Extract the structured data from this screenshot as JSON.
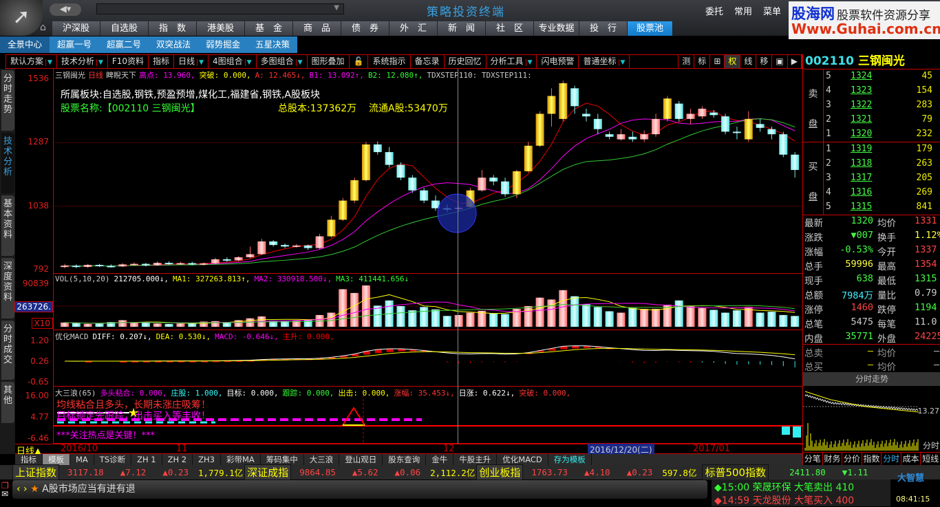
{
  "app": {
    "title": "策略投资终端",
    "top_links": [
      "委托",
      "常用",
      "菜单"
    ],
    "watermark": {
      "name": "股海网",
      "slogan": "股票软件资源分享",
      "url": "Www.Guhai.com.cn"
    }
  },
  "nav_tabs": [
    "沪深股",
    "自选股",
    "指　数",
    "港美股",
    "基　金",
    "商　品",
    "债　券",
    "外　汇",
    "新　闻",
    "社　区",
    "专业数据",
    "投　行",
    "股票池"
  ],
  "sub_tabs": [
    "全景中心",
    "超赢一号",
    "超赢二号",
    "双突战法",
    "弱势掘金",
    "五星决策"
  ],
  "toolbar": [
    {
      "label": "默认方案",
      "dd": true
    },
    {
      "label": "技术分析",
      "dd": true
    },
    {
      "label": "F10资料"
    },
    {
      "label": "指标"
    },
    {
      "label": "日线",
      "dd": true
    },
    {
      "label": "4图组合",
      "dd": true
    },
    {
      "label": "多图组合",
      "dd": true
    },
    {
      "label": "图形叠加"
    },
    {
      "label": "🔓"
    },
    {
      "label": "系统指示"
    },
    {
      "label": "备忘录"
    },
    {
      "label": "历史回忆"
    },
    {
      "label": "分析工具",
      "dd": true
    },
    {
      "label": "闪电预警"
    },
    {
      "label": "普通坐标",
      "dd": true
    }
  ],
  "toolbar_right": [
    "测",
    "标",
    "⊞",
    "权",
    "线",
    "移",
    "▣",
    "▶"
  ],
  "left_tabs": [
    "分时走势",
    "技术分析",
    "基本资料",
    "深度资料",
    "分时成交",
    "其他"
  ],
  "price_panel": {
    "name": "三钢闽光",
    "period": "日线",
    "indicator": "睥睨天下",
    "labels": [
      {
        "t": "高点: 13.960,",
        "c": "#f0f"
      },
      {
        "t": "突破: 0.000,",
        "c": "#ff0"
      },
      {
        "t": "A: 12.465↓,",
        "c": "#f33"
      },
      {
        "t": "B1: 13.092↑,",
        "c": "#f0f"
      },
      {
        "t": "B2: 12.080↑,",
        "c": "#3f3"
      },
      {
        "t": "TDXSTEP110: TDXSTEP111:",
        "c": "#ccc"
      }
    ],
    "sector": "所属板块:自选股,钢铁,预盈预增,煤化工,福建省,钢铁,A股板块",
    "stock_name": "股票名称:【002110 三钢闽光】",
    "total_shares": "总股本:137362万",
    "float_shares": "流通A股:53470万",
    "yaxis": [
      "1536",
      "1287",
      "1038",
      "792"
    ],
    "ylim": [
      792,
      1536
    ]
  },
  "candles": [
    [
      800,
      805,
      812,
      795
    ],
    [
      805,
      800,
      810,
      795
    ],
    [
      800,
      808,
      812,
      796
    ],
    [
      808,
      804,
      812,
      800
    ],
    [
      804,
      802,
      810,
      798
    ],
    [
      802,
      810,
      815,
      800
    ],
    [
      810,
      812,
      818,
      806
    ],
    [
      812,
      806,
      816,
      802
    ],
    [
      806,
      816,
      822,
      804
    ],
    [
      816,
      812,
      822,
      808
    ],
    [
      812,
      815,
      820,
      808
    ],
    [
      815,
      810,
      820,
      806
    ],
    [
      810,
      814,
      818,
      806
    ],
    [
      814,
      830,
      836,
      810
    ],
    [
      830,
      826,
      838,
      820
    ],
    [
      826,
      838,
      842,
      822
    ],
    [
      838,
      850,
      880,
      834
    ],
    [
      850,
      900,
      910,
      848
    ],
    [
      900,
      886,
      905,
      880
    ],
    [
      886,
      880,
      892,
      874
    ],
    [
      880,
      884,
      890,
      876
    ],
    [
      884,
      874,
      888,
      866
    ],
    [
      874,
      920,
      930,
      870
    ],
    [
      920,
      985,
      1000,
      915
    ],
    [
      985,
      1060,
      1070,
      980
    ],
    [
      1060,
      1140,
      1150,
      1050
    ],
    [
      1140,
      1280,
      1290,
      1135
    ],
    [
      1280,
      1250,
      1292,
      1240
    ],
    [
      1250,
      1200,
      1270,
      1190
    ],
    [
      1200,
      1150,
      1210,
      1140
    ],
    [
      1150,
      1100,
      1160,
      1090
    ],
    [
      1100,
      1060,
      1110,
      1050
    ],
    [
      1060,
      1030,
      1080,
      1020
    ],
    [
      1030,
      1028,
      1045,
      1015
    ],
    [
      1028,
      1032,
      1042,
      1018
    ],
    [
      1035,
      1100,
      1110,
      1030
    ],
    [
      1100,
      1150,
      1180,
      1095
    ],
    [
      1150,
      1135,
      1160,
      1120
    ],
    [
      1135,
      1085,
      1150,
      1075
    ],
    [
      1085,
      1175,
      1180,
      1070
    ],
    [
      1175,
      1275,
      1290,
      1170
    ],
    [
      1275,
      1400,
      1410,
      1270
    ],
    [
      1400,
      1470,
      1500,
      1350
    ],
    [
      1380,
      1520,
      1530,
      1370
    ],
    [
      1500,
      1430,
      1510,
      1400
    ],
    [
      1400,
      1390,
      1420,
      1370
    ],
    [
      1380,
      1340,
      1400,
      1320
    ],
    [
      1320,
      1310,
      1330,
      1300
    ],
    [
      1300,
      1320,
      1340,
      1295
    ],
    [
      1310,
      1300,
      1330,
      1290
    ],
    [
      1300,
      1320,
      1335,
      1290
    ],
    [
      1320,
      1380,
      1400,
      1310
    ],
    [
      1380,
      1460,
      1470,
      1370
    ],
    [
      1440,
      1380,
      1450,
      1370
    ],
    [
      1380,
      1400,
      1420,
      1360
    ],
    [
      1390,
      1420,
      1430,
      1380
    ],
    [
      1405,
      1395,
      1415,
      1385
    ],
    [
      1390,
      1330,
      1400,
      1320
    ],
    [
      1330,
      1325,
      1350,
      1300
    ],
    [
      1300,
      1380,
      1410,
      1290
    ],
    [
      1360,
      1345,
      1380,
      1330
    ],
    [
      1340,
      1320,
      1350,
      1300
    ],
    [
      1320,
      1240,
      1330,
      1230
    ],
    [
      1240,
      1180,
      1250,
      1150
    ]
  ],
  "volume_panel": {
    "header": [
      {
        "t": "VOL(5,10,20)",
        "c": "#ccc"
      },
      {
        "t": "212705.000↓,",
        "c": "#fff"
      },
      {
        "t": "MA1: 327263.813↑,",
        "c": "#ff0"
      },
      {
        "t": "MA2: 330918.500↓,",
        "c": "#f0f"
      },
      {
        "t": "MA3: 411441.656↓",
        "c": "#3f3"
      }
    ],
    "yaxis": [
      "90839",
      "263726.",
      "X10"
    ],
    "max": 908390,
    "values": [
      90000,
      80000,
      60000,
      70000,
      100000,
      140000,
      90000,
      100000,
      70000,
      60000,
      70000,
      70000,
      110000,
      120000,
      100000,
      140000,
      180000,
      220000,
      130000,
      120000,
      140000,
      150000,
      250000,
      300000,
      800000,
      720000,
      880000,
      450000,
      560000,
      440000,
      350000,
      420000,
      370000,
      230000,
      250000,
      300000,
      340000,
      290000,
      270000,
      380000,
      440000,
      620000,
      580000,
      780000,
      650000,
      480000,
      420000,
      330000,
      300000,
      400000,
      380000,
      380000,
      470000,
      560000,
      440000,
      400000,
      360000,
      300000,
      350000,
      420000,
      300000,
      320000,
      250000,
      230000
    ]
  },
  "macd_panel": {
    "header": [
      {
        "t": "优化MACD",
        "c": "#ccc"
      },
      {
        "t": "DIFF: 0.207↓,",
        "c": "#fff"
      },
      {
        "t": "DEA: 0.530↓,",
        "c": "#ff0"
      },
      {
        "t": "MACD: -0.646↓,",
        "c": "#f0f"
      },
      {
        "t": "主升: 0.000,",
        "c": "#f00"
      }
    ],
    "yaxis": [
      "1.20",
      "0.26",
      "-0.65"
    ]
  },
  "wave_panel": {
    "header": [
      {
        "t": "大三浪(65)",
        "c": "#ccc"
      },
      {
        "t": "多头粘合: 0.000,",
        "c": "#f0f"
      },
      {
        "t": "庄股: 1.000,",
        "c": "#3ff"
      },
      {
        "t": "目标: 0.000,",
        "c": "#fff"
      },
      {
        "t": "跟踪: 0.000,",
        "c": "#3f3"
      },
      {
        "t": "出击: 0.000,",
        "c": "#ff0"
      },
      {
        "t": "涨幅: 35.453↓,",
        "c": "#f33"
      },
      {
        "t": "日涨: 0.622↓,",
        "c": "#fff"
      },
      {
        "t": "突破: 0.000,",
        "c": "#f33"
      }
    ],
    "yaxis": [
      "16.00",
      "4.77",
      "-6.46"
    ],
    "msg1": "均线粘合且多头，长期未涨庄吸筹！",
    "msg2": "目标锁定先跟踪，出击买入等丰收！",
    "msg3": "***关注热点是关键！***"
  },
  "date_axis": {
    "period": "日线▲",
    "labels": [
      "2016/10",
      "11",
      "12",
      "2016/12/20(二)",
      "2017/01"
    ]
  },
  "bottom_tabs": [
    "指标",
    "模板",
    "MA",
    "TS诊断",
    "ZH 1",
    "ZH 2",
    "ZH3",
    "彩带MA",
    "筹码集中",
    "大三浪",
    "登山观日",
    "股东查询",
    "金牛",
    "牛股主升",
    "优化MACD",
    "存为模板"
  ],
  "quote": {
    "code": "002110",
    "name": "三钢闽光",
    "sell": [
      {
        "n": "5",
        "p": "1324",
        "v": "45"
      },
      {
        "n": "4",
        "p": "1323",
        "v": "154"
      },
      {
        "n": "3",
        "p": "1322",
        "v": "283"
      },
      {
        "n": "2",
        "p": "1321",
        "v": "79"
      },
      {
        "n": "1",
        "p": "1320",
        "v": "232"
      }
    ],
    "buy": [
      {
        "n": "1",
        "p": "1319",
        "v": "179"
      },
      {
        "n": "2",
        "p": "1318",
        "v": "263"
      },
      {
        "n": "3",
        "p": "1317",
        "v": "205"
      },
      {
        "n": "4",
        "p": "1316",
        "v": "269"
      },
      {
        "n": "5",
        "p": "1315",
        "v": "841"
      }
    ],
    "sell_label": [
      "卖",
      "盘"
    ],
    "buy_label": [
      "买",
      "盘"
    ],
    "stats": [
      [
        "最新",
        "1320",
        "#4f4",
        "均价",
        "1331",
        "#f44"
      ],
      [
        "涨跌",
        "▼007",
        "#4f4",
        "换手",
        "1.12%",
        "#ff4"
      ],
      [
        "涨幅",
        "-0.53%",
        "#4f4",
        "今开",
        "1337",
        "#f44"
      ],
      [
        "总手",
        "59996",
        "#ff4",
        "最高",
        "1354",
        "#f44"
      ],
      [
        "现手",
        "638",
        "#4f4",
        "最低",
        "1315",
        "#4f4"
      ],
      [
        "总额",
        "7984万",
        "#4ef",
        "量比",
        "0.79",
        "#ccc"
      ],
      [
        "涨停",
        "1460",
        "#f44",
        "跌停",
        "1194",
        "#4f4"
      ],
      [
        "总笔",
        "5475",
        "#ccc",
        "每笔",
        "11.0",
        "#ccc"
      ],
      [
        "内盘",
        "35771",
        "#4f4",
        "外盘",
        "24225",
        "#f44"
      ]
    ],
    "totals": [
      [
        "总卖",
        "—",
        "均价",
        "—"
      ],
      [
        "总买",
        "—",
        "均价",
        "—"
      ]
    ],
    "intraday_title": "分时走势",
    "intraday_label": "13.27",
    "intraday_side": "分时",
    "tabs": [
      "分笔",
      "财务",
      "分价",
      "指数",
      "分时",
      "成本",
      "短线"
    ]
  },
  "ticker": [
    {
      "name": "上证指数",
      "val": "3117.18",
      "chg": "▲7.12",
      "pct": "▲0.23",
      "amt": "1,779.1亿"
    },
    {
      "name": "深证成指",
      "val": "9864.85",
      "chg": "▲5.62",
      "pct": "▲0.06",
      "amt": "2,112.2亿"
    },
    {
      "name": "创业板指",
      "val": "1763.73",
      "chg": "▲4.10",
      "pct": "▲0.23",
      "amt": "597.8亿"
    }
  ],
  "sp500": {
    "name": "标普500指数",
    "val": "2411.80",
    "chg": "▼1.11"
  },
  "marquee": "A股市场应当有进有退",
  "alerts": [
    {
      "time": "15:00",
      "text": "荣晟环保 大笔卖出 410",
      "c": "#3f3"
    },
    {
      "time": "14:59",
      "text": "天龙股份 大笔买入 400",
      "c": "#f44"
    }
  ],
  "brand": "大智慧",
  "clock": "08:41:15"
}
